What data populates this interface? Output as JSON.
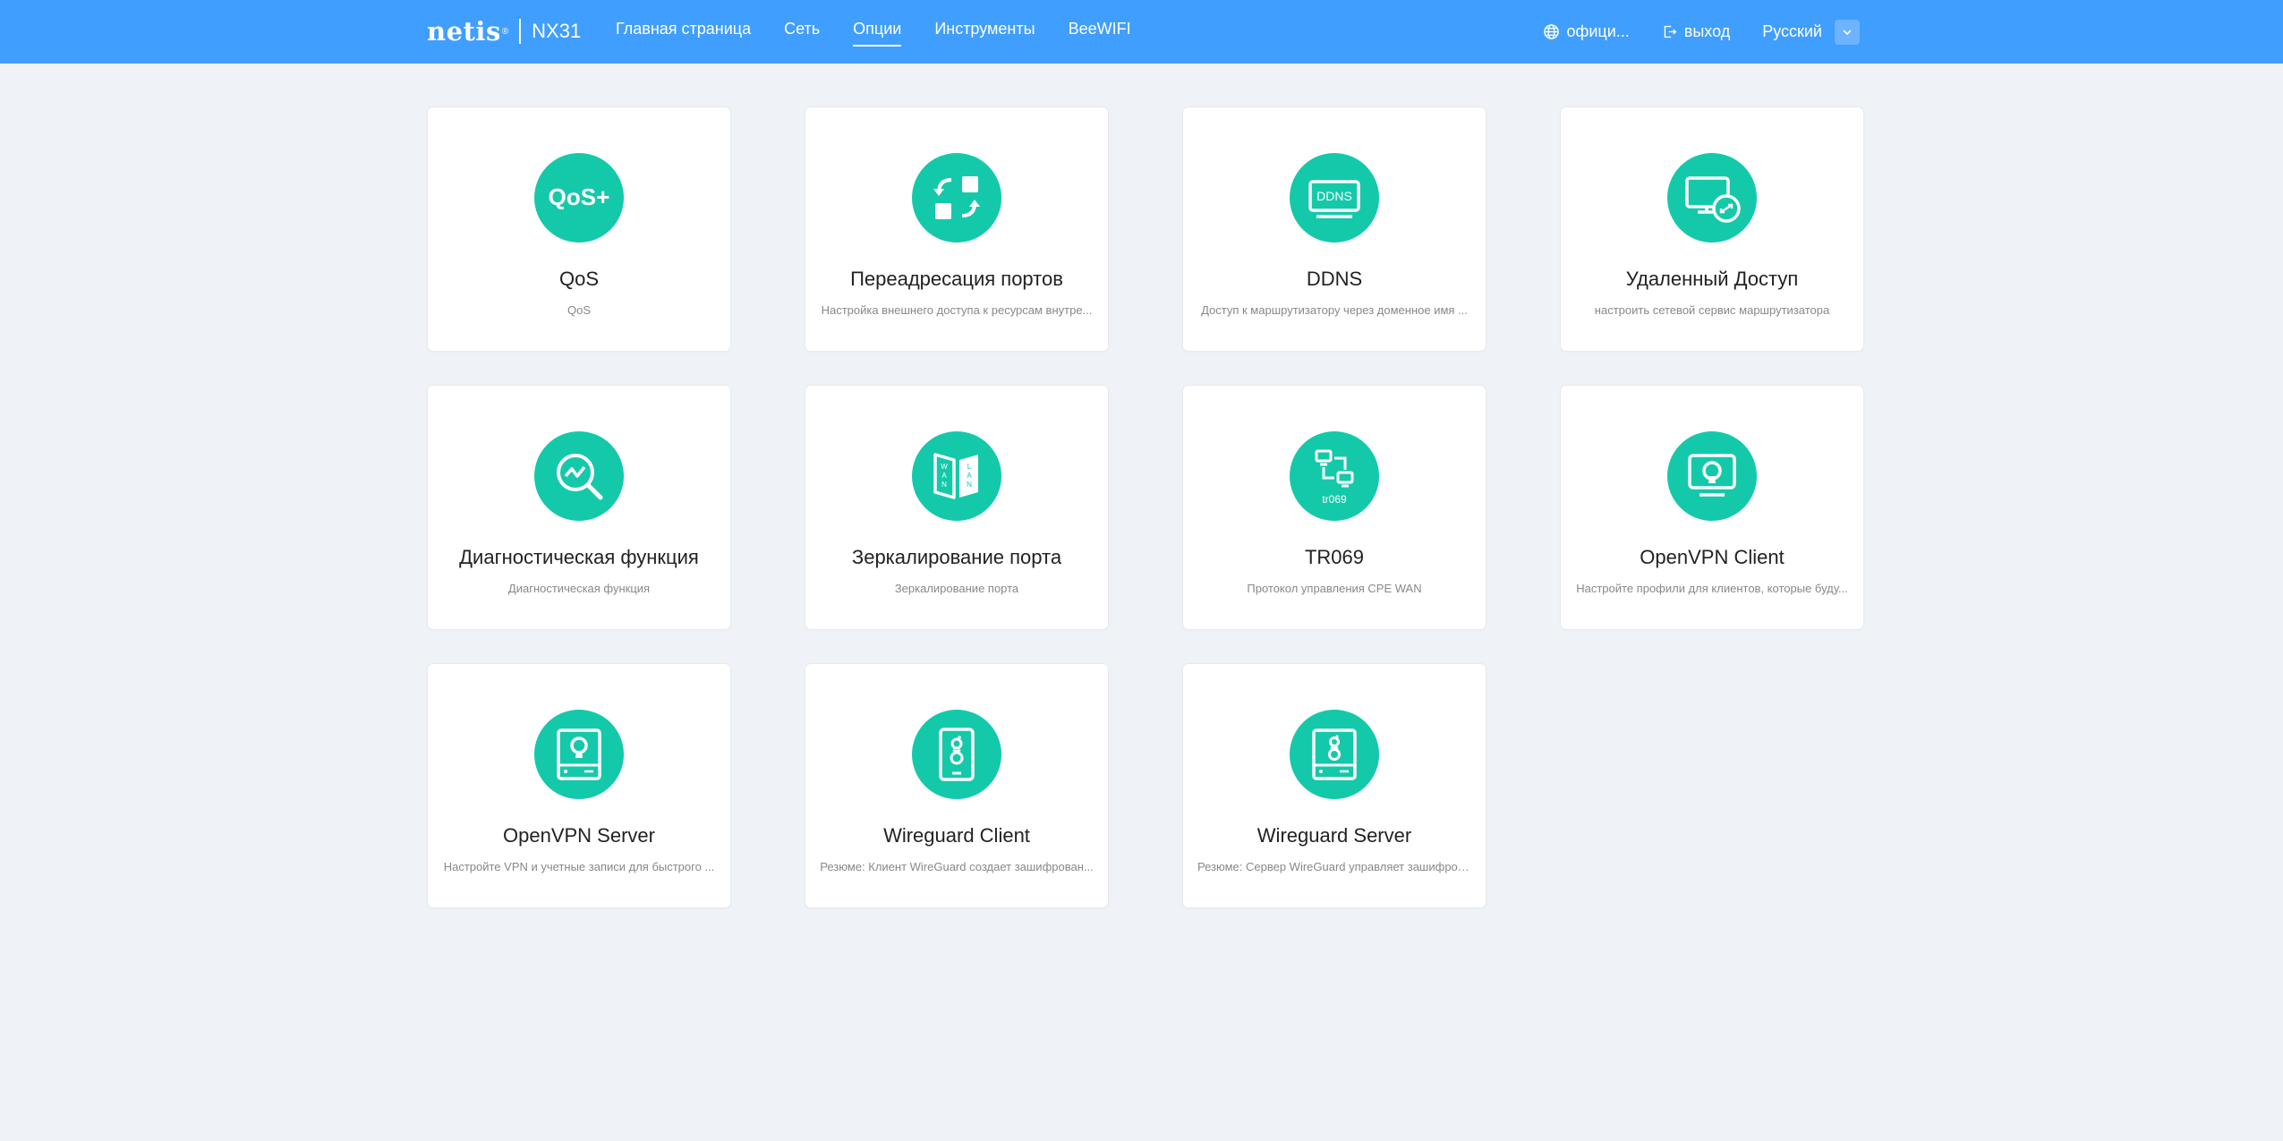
{
  "header": {
    "brand": "netis",
    "model": "NX31",
    "nav": [
      {
        "label": "Главная страница"
      },
      {
        "label": "Сеть"
      },
      {
        "label": "Опции",
        "active": true
      },
      {
        "label": "Инструменты"
      },
      {
        "label": "BeeWIFI"
      }
    ],
    "official_label": "офици...",
    "logout_label": "выход",
    "language": "Русский",
    "background_color": "#409eff"
  },
  "cards": [
    {
      "title": "QoS",
      "desc": "QoS",
      "icon": "qos-icon"
    },
    {
      "title": "Переадресация портов",
      "desc": "Настройка внешнего доступа к ресурсам внутре...",
      "icon": "port-forwarding-icon"
    },
    {
      "title": "DDNS",
      "desc": "Доступ к маршрутизатору через доменное имя ...",
      "icon": "ddns-icon"
    },
    {
      "title": "Удаленный Доступ",
      "desc": "настроить сетевой сервис маршрутизатора",
      "icon": "remote-access-icon"
    },
    {
      "title": "Диагностическая функция",
      "desc": "Диагностическая функция",
      "icon": "diagnostics-icon"
    },
    {
      "title": "Зеркалирование порта",
      "desc": "Зеркалирование порта",
      "icon": "port-mirroring-icon"
    },
    {
      "title": "TR069",
      "desc": "Протокол управления CPE WAN",
      "icon": "tr069-icon",
      "icon_text": "tr069"
    },
    {
      "title": "OpenVPN Client",
      "desc": "Настройте профили для клиентов, которые буду...",
      "icon": "openvpn-client-icon"
    },
    {
      "title": "OpenVPN Server",
      "desc": "Настройте VPN и учетные записи для быстрого ...",
      "icon": "openvpn-server-icon"
    },
    {
      "title": "Wireguard Client",
      "desc": "Резюме: Клиент WireGuard создает зашифрован...",
      "icon": "wireguard-client-icon"
    },
    {
      "title": "Wireguard Server",
      "desc": "Резюме: Сервер WireGuard управляет зашифров...",
      "icon": "wireguard-server-icon"
    }
  ],
  "colors": {
    "accent": "#14c9aa",
    "page_background": "#eff3f7"
  }
}
